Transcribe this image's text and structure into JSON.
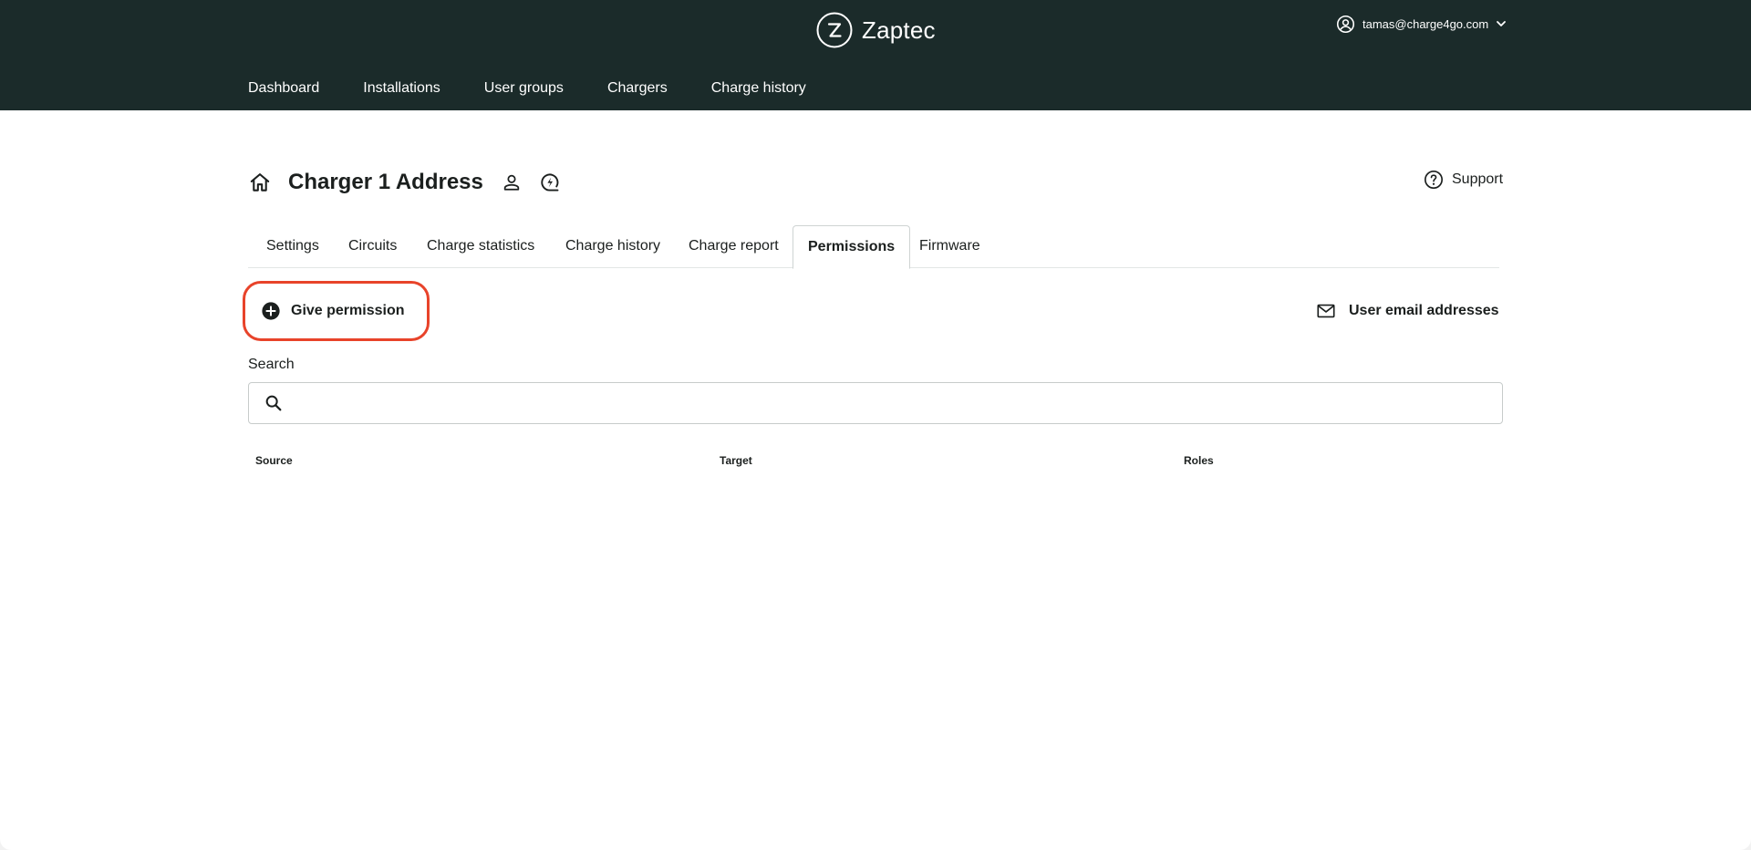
{
  "brand": {
    "name": "Zaptec",
    "logo_icon": "zaptec-logo-icon"
  },
  "account": {
    "email": "tamas@charge4go.com",
    "icon": "user-circle-icon"
  },
  "main_nav": [
    "Dashboard",
    "Installations",
    "User groups",
    "Chargers",
    "Charge history"
  ],
  "page": {
    "title": "Charger 1 Address",
    "support_label": "Support"
  },
  "tabs": [
    {
      "label": "Settings",
      "active": false
    },
    {
      "label": "Circuits",
      "active": false
    },
    {
      "label": "Charge statistics",
      "active": false
    },
    {
      "label": "Charge history",
      "active": false
    },
    {
      "label": "Charge report",
      "active": false
    },
    {
      "label": "Permissions",
      "active": true
    },
    {
      "label": "Firmware",
      "active": false
    }
  ],
  "actions": {
    "give_permission": "Give permission",
    "user_emails": "User email addresses"
  },
  "search": {
    "label": "Search",
    "placeholder": "",
    "value": ""
  },
  "table": {
    "columns": [
      "Source",
      "Target",
      "Roles"
    ],
    "rows": []
  },
  "colors": {
    "header_bg": "#1b2b2a",
    "highlight_ring": "#e8432a",
    "text": "#1b1f1e"
  }
}
